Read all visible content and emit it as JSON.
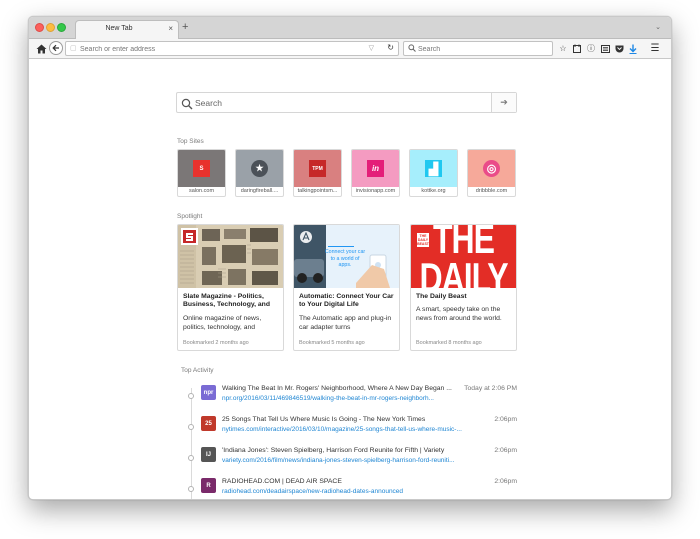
{
  "window": {
    "tab_title": "New Tab",
    "tab_close": "×",
    "new_tab_symbol": "+",
    "tab_menu_symbol": "⌄"
  },
  "toolbar": {
    "url_placeholder": "Search or enter address",
    "search_placeholder": "Search",
    "icons": [
      "home-icon",
      "back-icon",
      "reload-icon",
      "bookmark-star-icon",
      "reading-list-icon",
      "identity-icon",
      "reader-view-icon",
      "pocket-icon",
      "download-icon",
      "menu-icon"
    ]
  },
  "main": {
    "search_placeholder": "Search",
    "go_symbol": "➔",
    "top_sites_title": "Top Sites",
    "spotlight_title": "Spotlight",
    "activity_title": "Top Activity"
  },
  "top_sites": [
    {
      "label": "salon.com",
      "bg": "#7b7777",
      "icon_bg": "#e8322d",
      "icon": "S",
      "icon_name": "salon-icon"
    },
    {
      "label": "daringfireball....",
      "bg": "#9aa1a8",
      "icon_bg": "#4b5158",
      "icon": "★",
      "icon_name": "star-icon"
    },
    {
      "label": "talkingpointsm...",
      "bg": "#d98080",
      "icon_bg": "#c62828",
      "icon": "TPM",
      "icon_name": "tpm-icon"
    },
    {
      "label": "invisionapp.com",
      "bg": "#f49bc1",
      "icon_bg": "#e41e79",
      "icon": "in",
      "icon_name": "invision-icon"
    },
    {
      "label": "kottke.org",
      "bg": "#a6eefc",
      "icon_bg": "#20c8f0",
      "icon": "▟",
      "icon_name": "kottke-icon"
    },
    {
      "label": "dribbble.com",
      "bg": "#f6a99a",
      "icon_bg": "#ea4c89",
      "icon": "◎",
      "icon_name": "dribbble-icon"
    }
  ],
  "spotlight": [
    {
      "title": "Slate Magazine - Politics, Business, Technology, and",
      "desc": "Online magazine of news, politics, technology, and",
      "meta": "Bookmarked 2 months ago"
    },
    {
      "title": "Automatic: Connect Your Car to Your Digital Life",
      "desc": "The Automatic app and plug-in car adapter turns",
      "meta": "Bookmarked 5 months ago",
      "image_text": "Connect your car to a world of apps."
    },
    {
      "title": "The Daily Beast",
      "desc": "A smart, speedy take on the news from around the world.",
      "meta": "Bookmarked 8 months ago",
      "image_text_small": "THE DAILY BEAST",
      "image_text_big": "THE DAILY BEAST"
    }
  ],
  "activity": [
    {
      "title": "Walking The Beat In Mr. Rogers' Neighborhood, Where A New Day Began ...",
      "url": "npr.org/2016/03/11/469846519/walking-the-beat-in-mr-rogers-neighborh...",
      "time": "Today at 2:06 PM",
      "fav_bg": "#7a6bd4",
      "fav": "npr"
    },
    {
      "title": "25 Songs That Tell Us Where Music Is Going - The New York Times",
      "url": "nytimes.com/interactive/2016/03/10/magazine/25-songs-that-tell-us-where-music-...",
      "time": "2:06pm",
      "fav_bg": "#c0392b",
      "fav": "25"
    },
    {
      "title": "'Indiana Jones': Steven Spielberg, Harrison Ford Reunite for Fifth | Variety",
      "url": "variety.com/2016/film/news/indiana-jones-steven-spielberg-harrison-ford-reuniti...",
      "time": "2:06pm",
      "fav_bg": "#555555",
      "fav": "IJ"
    },
    {
      "title": "RADIOHEAD.COM | DEAD AIR SPACE",
      "url": "radiohead.com/deadairspace/new-radiohead-dates-announced",
      "time": "2:06pm",
      "fav_bg": "#7a2a6a",
      "fav": "R"
    }
  ]
}
